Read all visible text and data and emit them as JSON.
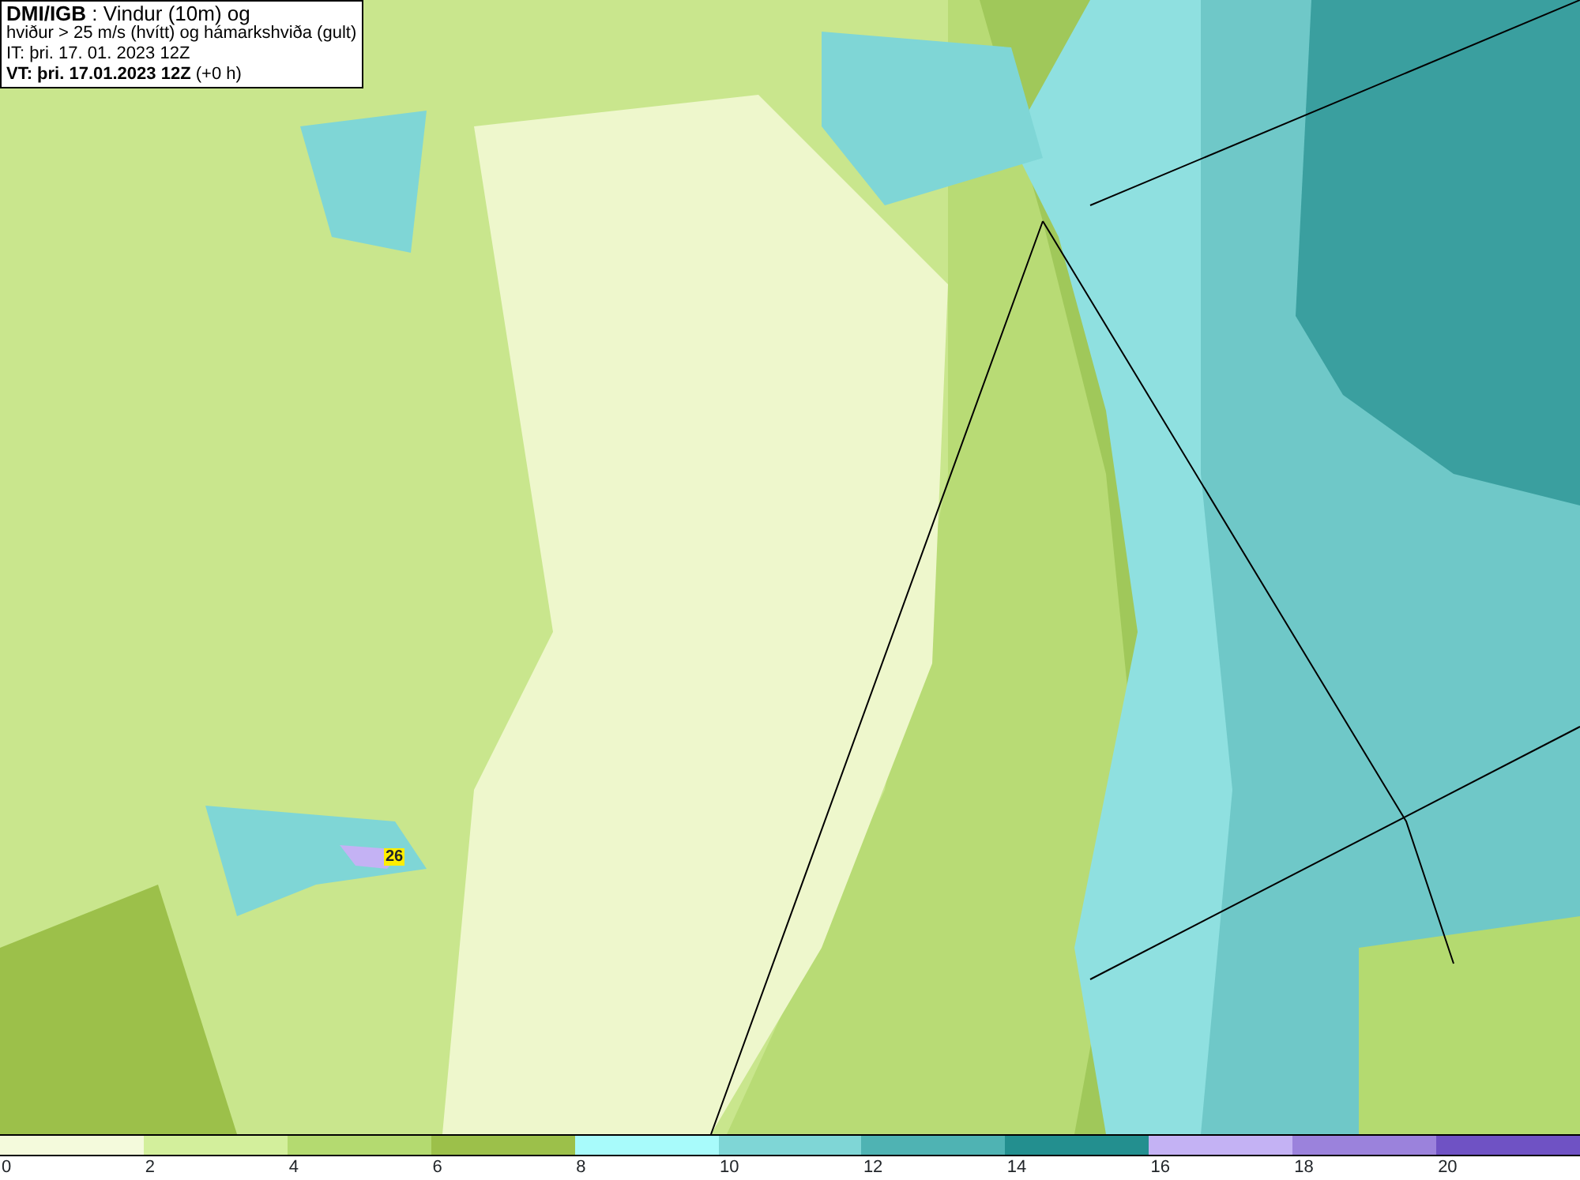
{
  "header": {
    "lines": [
      "**DMI/IGB** : Vindur (10m) og",
      "hviður > 25 m/s (hvítt) og hámarkshviða (gult)",
      "IT: þri. 17. 01. 2023 12Z",
      "**VT: þri. 17.01.2023 12Z** (+0 h)"
    ]
  },
  "map": {
    "max_gust_label": "26"
  },
  "legend": {
    "swatches": [
      {
        "color": "#f4fadc"
      },
      {
        "color": "#d3ef9c"
      },
      {
        "color": "#b4da70"
      },
      {
        "color": "#9cc04a"
      },
      {
        "color": "#a8fbfb"
      },
      {
        "color": "#7fd6d6"
      },
      {
        "color": "#4fb3b3"
      },
      {
        "color": "#238f8f"
      },
      {
        "color": "#c4b2f4"
      },
      {
        "color": "#9b82dc"
      },
      {
        "color": "#6f52c4"
      }
    ],
    "labels": [
      "0",
      "2",
      "4",
      "6",
      "8",
      "10",
      "12",
      "14",
      "16",
      "18",
      "20"
    ]
  }
}
